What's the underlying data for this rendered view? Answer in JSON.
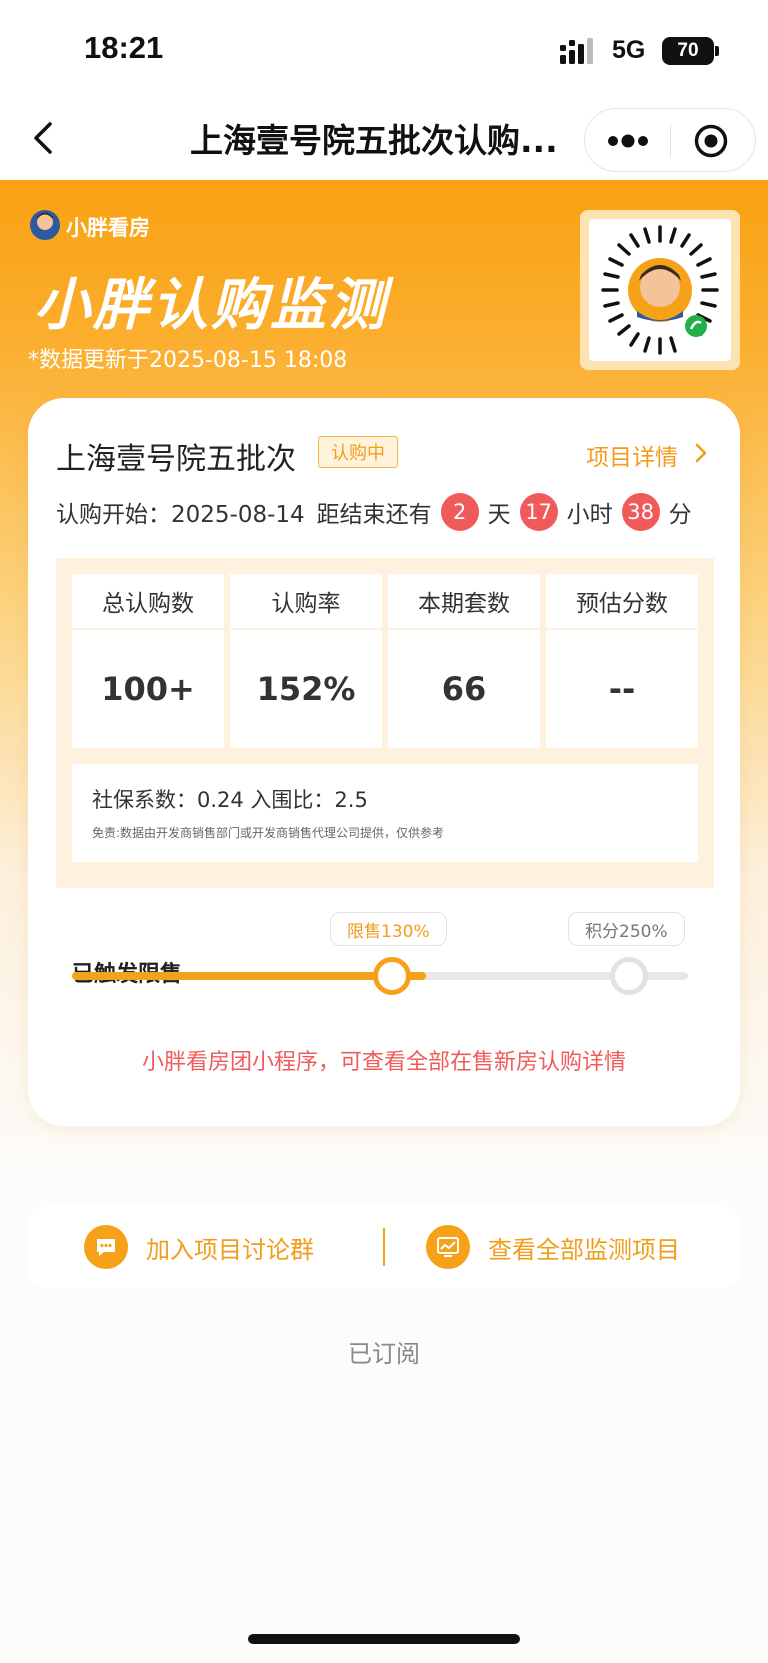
{
  "status_bar": {
    "time": "18:21",
    "network": "5G",
    "battery": "70"
  },
  "nav": {
    "title": "上海壹号院五批次认购..."
  },
  "hero": {
    "brand": "小胖看房",
    "title": "小胖认购监测",
    "updated": "*数据更新于2025-08-15 18:08"
  },
  "project": {
    "name": "上海壹号院五批次",
    "status": "认购中",
    "detail_link": "项目详情",
    "start_label": "认购开始：2025-08-14",
    "countdown_prefix": "距结束还有",
    "days": "2",
    "days_unit": "天",
    "hours": "17",
    "hours_unit": "小时",
    "minutes": "38",
    "minutes_unit": "分"
  },
  "stats": [
    {
      "label": "总认购数",
      "value": "100+"
    },
    {
      "label": "认购率",
      "value": "152%"
    },
    {
      "label": "本期套数",
      "value": "66"
    },
    {
      "label": "预估分数",
      "value": "--"
    }
  ],
  "info": {
    "line": "社保系数：0.24  入围比：2.5",
    "disclaimer": "免责:数据由开发商销售部门或开发商销售代理公司提供，仅供参考"
  },
  "progress": {
    "label": "已触发限售",
    "tag_limit": "限售130%",
    "tag_points": "积分250%"
  },
  "promo": "小胖看房团小程序，可查看全部在售新房认购详情",
  "actions": {
    "join": "加入项目讨论群",
    "view_all": "查看全部监测项目"
  },
  "subscribed": "已订阅",
  "colors": {
    "accent": "#f5a219",
    "alert": "#f05a5a",
    "hero_top": "#f9a112"
  }
}
